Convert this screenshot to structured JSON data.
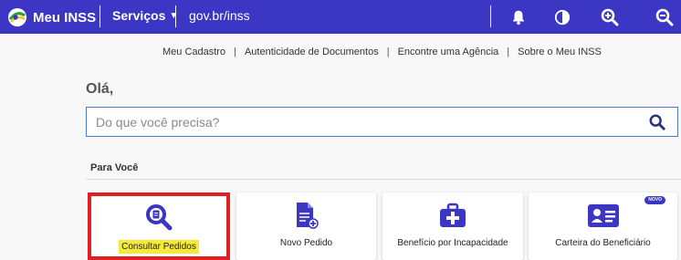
{
  "topbar": {
    "brand": "Meu INSS",
    "services": "Serviços",
    "govbr": "gov.br/inss",
    "colors": {
      "background": "#3b36c4",
      "text": "#ffffff"
    },
    "icons": [
      "inss-logo-icon",
      "chevron-down-icon",
      "bell-icon",
      "contrast-icon",
      "zoom-in-icon",
      "zoom-out-icon"
    ]
  },
  "subnav": {
    "items": [
      "Meu Cadastro",
      "Autenticidade de Documentos",
      "Encontre uma Agência",
      "Sobre o Meu INSS"
    ]
  },
  "greeting": "Olá,",
  "search": {
    "placeholder": "Do que você precisa?",
    "value": "",
    "icon": "search-icon"
  },
  "section": {
    "title": "Para Você"
  },
  "cards": [
    {
      "label": "Consultar Pedidos",
      "icon": "document-search-icon",
      "highlighted": true
    },
    {
      "label": "Novo Pedido",
      "icon": "new-document-icon"
    },
    {
      "label": "Benefício por Incapacidade",
      "icon": "medical-kit-icon"
    },
    {
      "label": "Carteira do Beneficiário",
      "icon": "id-card-icon",
      "badge": "NOVO"
    }
  ],
  "colors": {
    "accent": "#3b36c4",
    "highlight_border": "#e01f1f",
    "highlight_text_bg": "#f5e93a"
  }
}
